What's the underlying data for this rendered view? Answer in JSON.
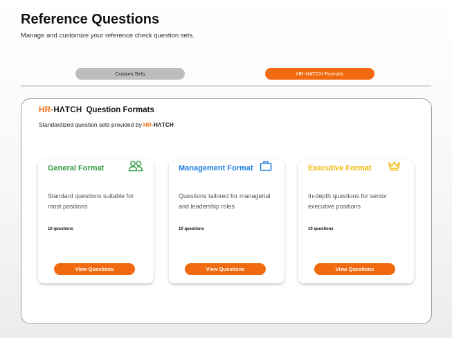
{
  "page": {
    "title": "Reference Questions",
    "subtitle": "Manage and customize your reference check question sets."
  },
  "tabs": [
    {
      "label": "Custom Sets",
      "active": false
    },
    {
      "label": "HR-HATCH Formats",
      "active": true
    }
  ],
  "brand": {
    "prefix": "HR-",
    "name": "HΛTCH"
  },
  "panel": {
    "heading": "Question Formats",
    "description": "Standardized question sets provided by"
  },
  "cards": [
    {
      "title": "General Format",
      "icon": "users-icon",
      "color": "#2e9a3e",
      "description": "Standard questions suitable for most positions",
      "count": "10 questions",
      "button": "View Questions"
    },
    {
      "title": "Management Format",
      "icon": "briefcase-icon",
      "color": "#1f7fe0",
      "description": "Questions tailored for managerial and leadership roles",
      "count": "10 questions",
      "button": "View Questions"
    },
    {
      "title": "Executive Format",
      "icon": "crown-icon",
      "color": "#f2b500",
      "description": "In-depth questions for senior executive positions",
      "count": "10 questions",
      "button": "View Questions"
    }
  ],
  "colors": {
    "accent": "#f26a0f",
    "inactive_tab": "#bdbdbd"
  }
}
